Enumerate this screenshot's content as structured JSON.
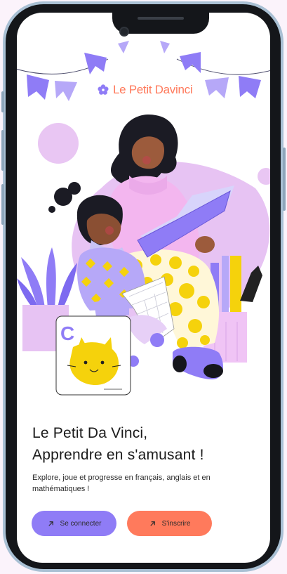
{
  "brand": {
    "name": "Le Petit Davinci"
  },
  "hero": {
    "title_line1": "Le Petit Da Vinci,",
    "title_line2": "Apprendre en s'amusant !",
    "subtitle": "Explore, joue et progresse en français, anglais et en mathématiques !"
  },
  "actions": {
    "login_label": "Se connecter",
    "signup_label": "S'inscrire"
  },
  "illustration": {
    "card_letter": "C"
  },
  "colors": {
    "brand_orange": "#ff7a5c",
    "brand_purple": "#8f7cf6",
    "lilac": "#e7c3f3",
    "yellow": "#f5d20c"
  }
}
